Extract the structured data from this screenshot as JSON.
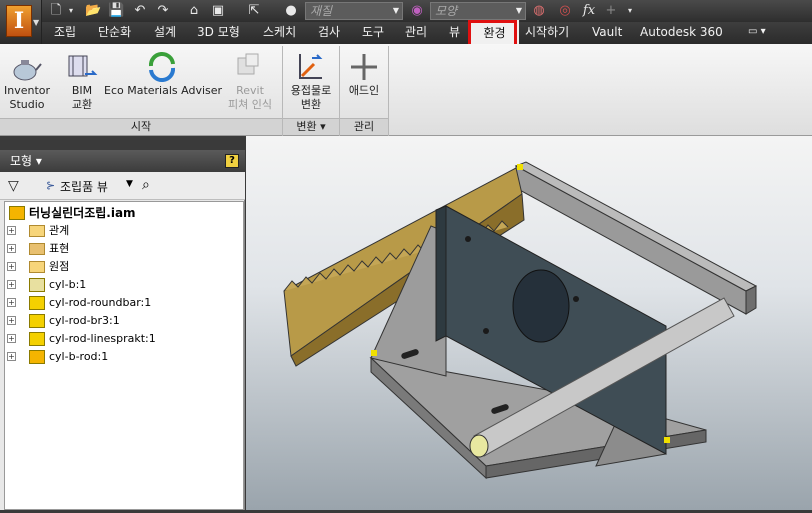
{
  "qat": {
    "material_placeholder": "재질",
    "appearance_placeholder": "모양",
    "fx": "fx"
  },
  "menu": {
    "tabs": [
      "조립",
      "단순화",
      "설계",
      "3D 모형",
      "스케치",
      "검사",
      "도구",
      "관리",
      "뷰",
      "환경",
      "시작하기",
      "Vault",
      "Autodesk 360"
    ],
    "active": "환경"
  },
  "ribbon": {
    "buttons": [
      {
        "label": "Inventor\nStudio"
      },
      {
        "label": "BIM\n교환"
      },
      {
        "label": "Eco Materials Adviser"
      },
      {
        "label": "Revit\n피쳐 인식",
        "disabled": true
      },
      {
        "label": "용접물로\n변환"
      },
      {
        "label": "애드인"
      }
    ],
    "groups": [
      "시작",
      "변환 ▾",
      "관리"
    ]
  },
  "browser": {
    "title": "모형 ▾",
    "help": "?",
    "view_label": "조립품 뷰",
    "root": "터닝실린더조립.iam",
    "items": [
      "관계",
      "표현",
      "원점",
      "cyl-b:1",
      "cyl-rod-roundbar:1",
      "cyl-rod-br3:1",
      "cyl-rod-linesprakt:1",
      "cyl-b-rod:1"
    ]
  },
  "colors": {
    "highlight": "#e01010",
    "rack": "#a88a3c",
    "plate": "#3f4d55",
    "frame": "#888888"
  }
}
